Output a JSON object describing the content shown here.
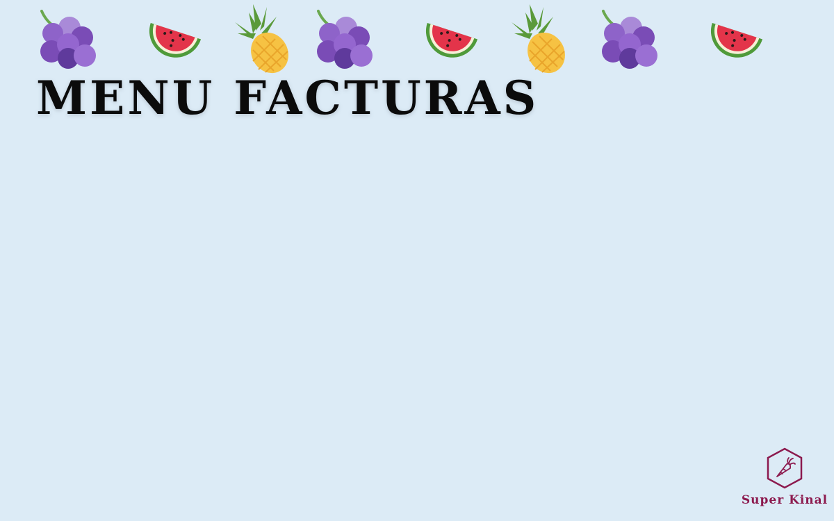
{
  "title": "MENU FACTURAS",
  "decorations": [
    "grapes-icon",
    "watermelon-slice-icon",
    "pineapple-icon",
    "grapes-icon",
    "watermelon-slice-icon",
    "pineapple-icon",
    "grapes-icon",
    "watermelon-slice-icon"
  ],
  "brand": {
    "name": "Super Kinal",
    "icon": "carrot-hexagon-icon"
  },
  "colors": {
    "background": "#dcebf6",
    "title": "#0b0b0b",
    "brand": "#8c1a4e",
    "grape": "#7b4fb8",
    "watermelon": "#e3344a",
    "pineapple": "#f6c243",
    "leaf": "#5a9a3a"
  }
}
